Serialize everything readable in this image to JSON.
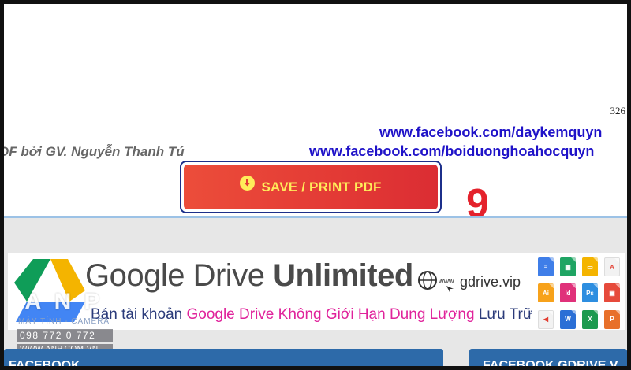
{
  "document": {
    "page_number": "326",
    "author_line": "DF bởi GV. Nguyễn Thanh Tú",
    "links": [
      "www.facebook.com/daykemquyn",
      "www.facebook.com/boiduonghoahocquyn"
    ]
  },
  "save_button": {
    "label": "SAVE / PRINT PDF",
    "icon": "download-circle-icon",
    "color": "#e33a35",
    "text_color": "#ffec5a"
  },
  "annotation": {
    "step_number": "9",
    "color": "#e4222c"
  },
  "banner": {
    "title_regular": "Google Drive ",
    "title_bold": "Unlimited",
    "url": "gdrive.vip",
    "url_prefix": "www",
    "tagline_part1": "Bán tài khoản ",
    "tagline_part2": "Google Drive Không Giới Hạn Dung Lượng",
    "tagline_part3": " Lưu Trữ",
    "file_icons": [
      {
        "name": "docs-icon",
        "color": "#3f7ee8",
        "label": "≡"
      },
      {
        "name": "sheets-icon",
        "color": "#1fa463",
        "label": "▦"
      },
      {
        "name": "slides-icon",
        "color": "#f4b400",
        "label": "▭"
      },
      {
        "name": "pdf-icon",
        "color": "#f2f2f2",
        "label": "A"
      },
      {
        "name": "ai-icon",
        "color": "#f7a21b",
        "label": "Ai"
      },
      {
        "name": "indesign-icon",
        "color": "#e0317a",
        "label": "Id"
      },
      {
        "name": "photoshop-icon",
        "color": "#2d8ee0",
        "label": "Ps"
      },
      {
        "name": "image-icon",
        "color": "#e64a3b",
        "label": "▣"
      },
      {
        "name": "audio-icon",
        "color": "#f2f2f2",
        "label": "◀"
      },
      {
        "name": "word-icon",
        "color": "#2b6fd6",
        "label": "W"
      },
      {
        "name": "excel-icon",
        "color": "#1d9a4f",
        "label": "X"
      },
      {
        "name": "powerpoint-icon",
        "color": "#e8702a",
        "label": "P"
      }
    ]
  },
  "watermark": {
    "logo": "ANP",
    "tag": "MÁY TÍNH - CAMERA",
    "phone": "098 772 0 772",
    "site": "WWW.ANP.COM.VN"
  },
  "panels": {
    "left_title": "FACEBOOK",
    "right_title": "FACEBOOK GDRIVE.V"
  }
}
